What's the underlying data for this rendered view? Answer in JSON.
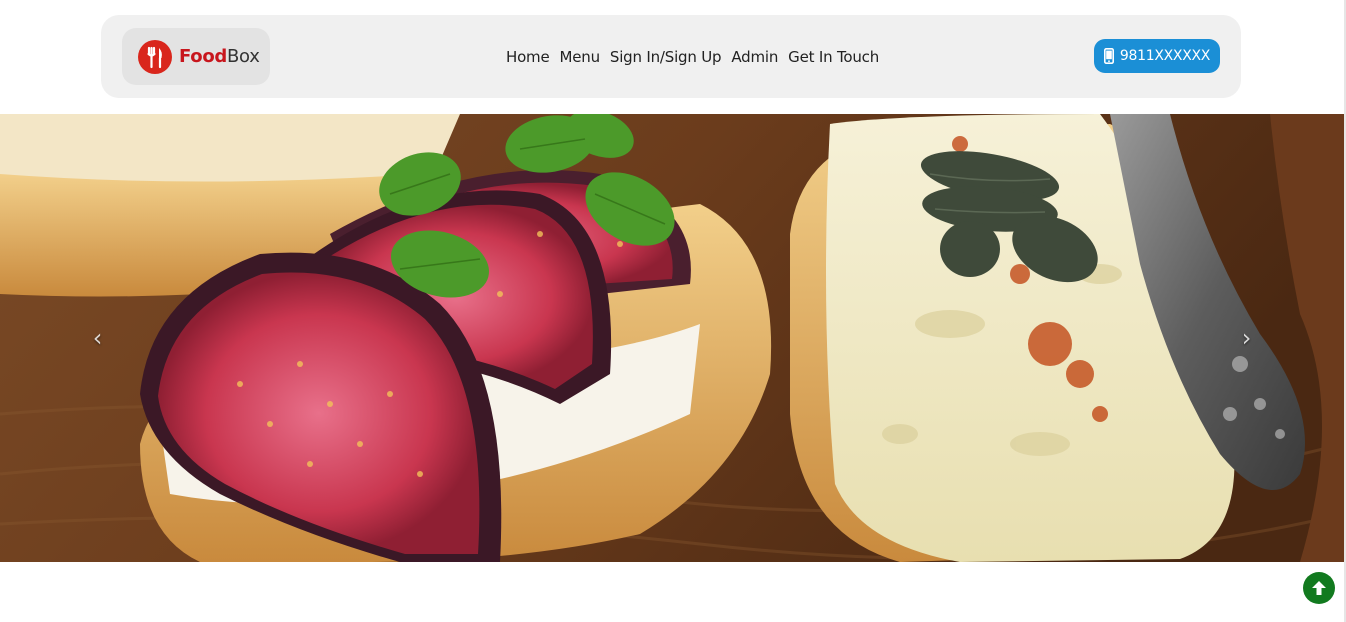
{
  "brand": {
    "name_bold": "Food",
    "name_rest": "Box",
    "icon": "utensils-icon",
    "accent": "#c8161d"
  },
  "nav": {
    "items": [
      "Home",
      "Menu",
      "Sign In/Sign Up",
      "Admin",
      "Get In Touch"
    ]
  },
  "contact": {
    "phone": "9811XXXXXX",
    "icon": "mobile-phone-icon",
    "color": "#1b8fd6"
  },
  "carousel": {
    "prev_icon": "chevron-left-icon",
    "next_icon": "chevron-right-icon",
    "prev_glyph": "‹",
    "next_glyph": "›"
  },
  "scroll_top": {
    "icon": "arrow-up-circle-icon",
    "color": "#127a1f"
  }
}
